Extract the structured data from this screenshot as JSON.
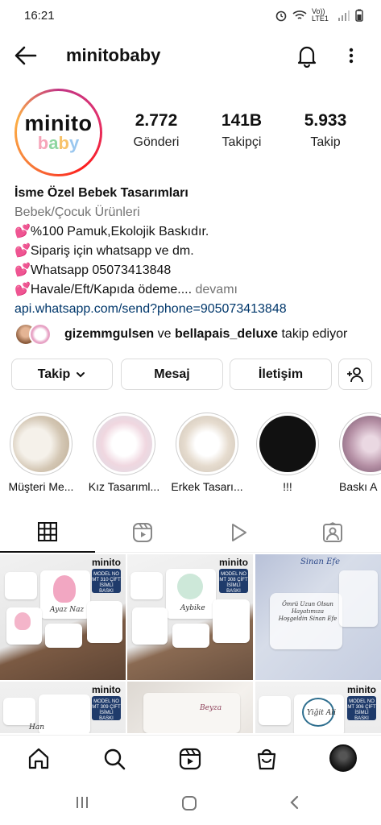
{
  "status_bar": {
    "time": "16:21",
    "network": "Vo)) LTE1"
  },
  "nav": {
    "username": "minitobaby"
  },
  "profile": {
    "logo_top": "minito",
    "logo_bottom": [
      "b",
      "a",
      "b",
      "y"
    ],
    "stats": [
      {
        "value": "2.772",
        "label": "Gönderi"
      },
      {
        "value": "141B",
        "label": "Takipçi"
      },
      {
        "value": "5.933",
        "label": "Takip"
      }
    ]
  },
  "bio": {
    "name": "İsme Özel Bebek Tasarımları",
    "category": "Bebek/Çocuk Ürünleri",
    "lines": [
      "%100 Pamuk,Ekolojik Baskıdır.",
      "Sipariş için whatsapp ve dm.",
      "Whatsapp 05073413848",
      "Havale/Eft/Kapıda ödeme...."
    ],
    "more": "devamı",
    "link": "api.whatsapp.com/send?phone=905073413848",
    "heart": "💕"
  },
  "followed_by": {
    "user1": "gizemmgulsen",
    "connector": "ve",
    "user2": "bellapais_deluxe",
    "suffix": "takip ediyor"
  },
  "actions": {
    "follow": "Takip",
    "follow_caret": "⌄",
    "message": "Mesaj",
    "contact": "İletişim"
  },
  "highlights": [
    {
      "label": "Müşteri Me...",
      "color": "#e9e2d8"
    },
    {
      "label": "Kız Tasarıml...",
      "color": "#eef0f2"
    },
    {
      "label": "Erkek Tasarı...",
      "color": "#f1eee9"
    },
    {
      "label": "!!!",
      "color": "#111111"
    },
    {
      "label": "Baskı A",
      "color": "#c7b8c4"
    }
  ],
  "posts": [
    {
      "brand": "minito",
      "badge": "MODEL NO MT 310 ÇİFT İSİMLİ BASKI",
      "caption": "Ayaz Naz"
    },
    {
      "brand": "minito",
      "badge": "MODEL NO MT 308 ÇİFT İSİMLİ BASKI",
      "caption": "Aybike"
    },
    {
      "brand": "",
      "badge": "",
      "caption": "Sinan Efe"
    },
    {
      "brand": "minito",
      "badge": "MODEL NO MT 309 ÇİFT İSİMLİ BASKI",
      "caption": "Han"
    },
    {
      "brand": "",
      "badge": "",
      "caption": "Beyza"
    },
    {
      "brand": "minito",
      "badge": "MODEL NO MT 306 ÇİFT İSİMLİ BASKI",
      "caption": "Yiğit Ali"
    }
  ],
  "post3_text": "Ömrü Uzun Olsun Hayatımıza Hoşgeldin Sinan Efe"
}
